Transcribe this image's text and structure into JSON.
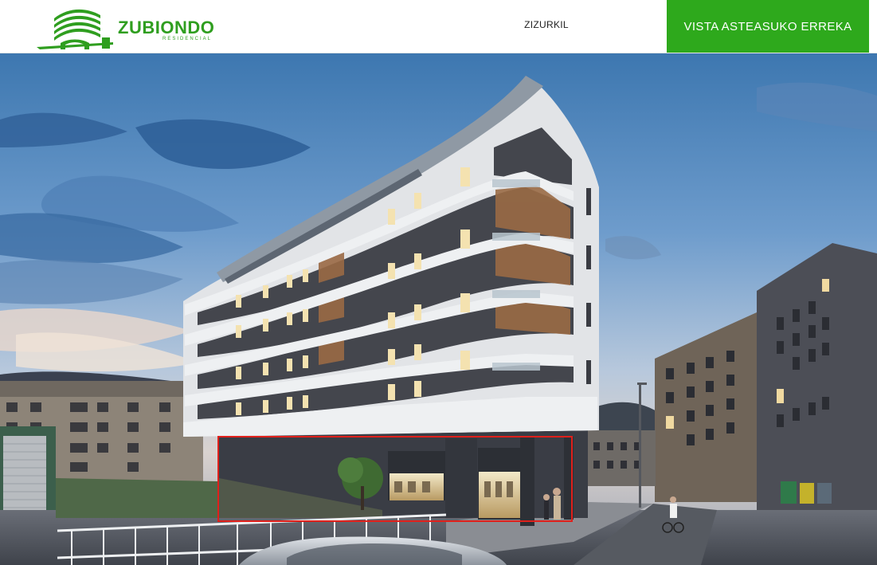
{
  "header": {
    "logo_name": "ZUBIONDO",
    "logo_sub": "RESIDENCIAL",
    "logo_icon": "zubiondo-building-bridge-logo",
    "nav": [
      {
        "label": "ZIZURKIL"
      }
    ],
    "cta_label": "VISTA ASTEASUKO ERREKA"
  },
  "hero": {
    "image_subject": "residential building rendering at dusk",
    "highlight_color": "#e0201b"
  },
  "colors": {
    "brand_green": "#2ea91c",
    "logo_green": "#2f9e1f"
  }
}
